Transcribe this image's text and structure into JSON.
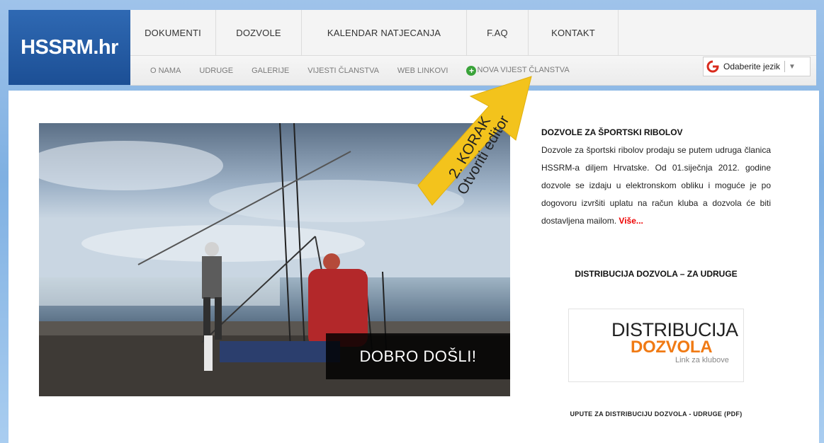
{
  "logo": "HSSRM.hr",
  "main_nav": [
    {
      "label": "DOKUMENTI"
    },
    {
      "label": "DOZVOLE"
    },
    {
      "label": "KALENDAR NATJECANJA"
    },
    {
      "label": "F.AQ"
    },
    {
      "label": "KONTAKT"
    }
  ],
  "sub_nav": [
    {
      "label": "O NAMA"
    },
    {
      "label": "UDRUGE"
    },
    {
      "label": "GALERIJE"
    },
    {
      "label": "VIJESTI ČLANSTVA"
    },
    {
      "label": "WEB LINKOVI"
    }
  ],
  "new_article_label": "NOVA VIJEST ČLANSTVA",
  "language_select": "Odaberite jezik",
  "hero": {
    "welcome": "DOBRO DOŠLI!"
  },
  "permits": {
    "title": "DOZVOLE ZA ŠPORTSKI RIBOLOV",
    "text": "Dozvole za športski ribolov prodaju se putem udruga članica HSSRM-a diljem Hrvatske. Od 01.siječnja 2012. godine dozvole se izdaju u elektronskom obliku i moguće je po dogovoru izvršiti uplatu na račun kluba a dozvola će biti dostavljena mailom.",
    "more": "Više..."
  },
  "distribution": {
    "title": "DISTRIBUCIJA DOZVOLA  – ZA UDRUGE",
    "banner_line1": "DISTRIBUCIJA",
    "banner_line2": "DOZVOLA",
    "banner_line3": "Link za klubove",
    "pdf_link": "UPUTE ZA DISTRIBUCIJU DOZVOLA - UDRUGE (PDF)"
  },
  "annotation": {
    "line1": "2. KORAK",
    "line2": "Otvoriti editor"
  },
  "colors": {
    "logo_bg": "#1f549c",
    "accent_red": "#e00000",
    "accent_orange": "#f07a14",
    "arrow": "#f3c31c"
  }
}
